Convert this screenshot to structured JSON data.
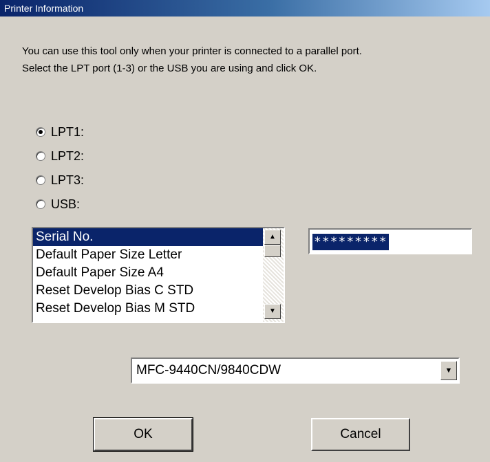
{
  "window": {
    "title": "Printer Information"
  },
  "instructions": {
    "line1": "You can use this tool only when your printer is connected to a parallel port.",
    "line2": "Select the LPT port (1-3) or the USB you are using and click OK."
  },
  "ports": {
    "selected": "LPT1:",
    "options": [
      {
        "label": "LPT1:",
        "checked": true
      },
      {
        "label": "LPT2:",
        "checked": false
      },
      {
        "label": "LPT3:",
        "checked": false
      },
      {
        "label": "USB:",
        "checked": false
      }
    ]
  },
  "function_list": {
    "selected_index": 0,
    "items": [
      "Serial No.",
      "Default Paper Size Letter",
      "Default Paper Size A4",
      "Reset Develop Bias C STD",
      "Reset Develop Bias M STD"
    ]
  },
  "serial_field": {
    "value": "*********"
  },
  "model_select": {
    "value": "MFC-9440CN/9840CDW"
  },
  "buttons": {
    "ok": "OK",
    "cancel": "Cancel"
  },
  "icons": {
    "radio": "radio-button-icon",
    "scroll_up": "scroll-up-arrow-icon",
    "scroll_down": "scroll-down-arrow-icon",
    "dropdown": "chevron-down-icon"
  },
  "colors": {
    "dialog_bg": "#d4d0c8",
    "titlebar": "#0a246a",
    "selection": "#0a246a"
  }
}
